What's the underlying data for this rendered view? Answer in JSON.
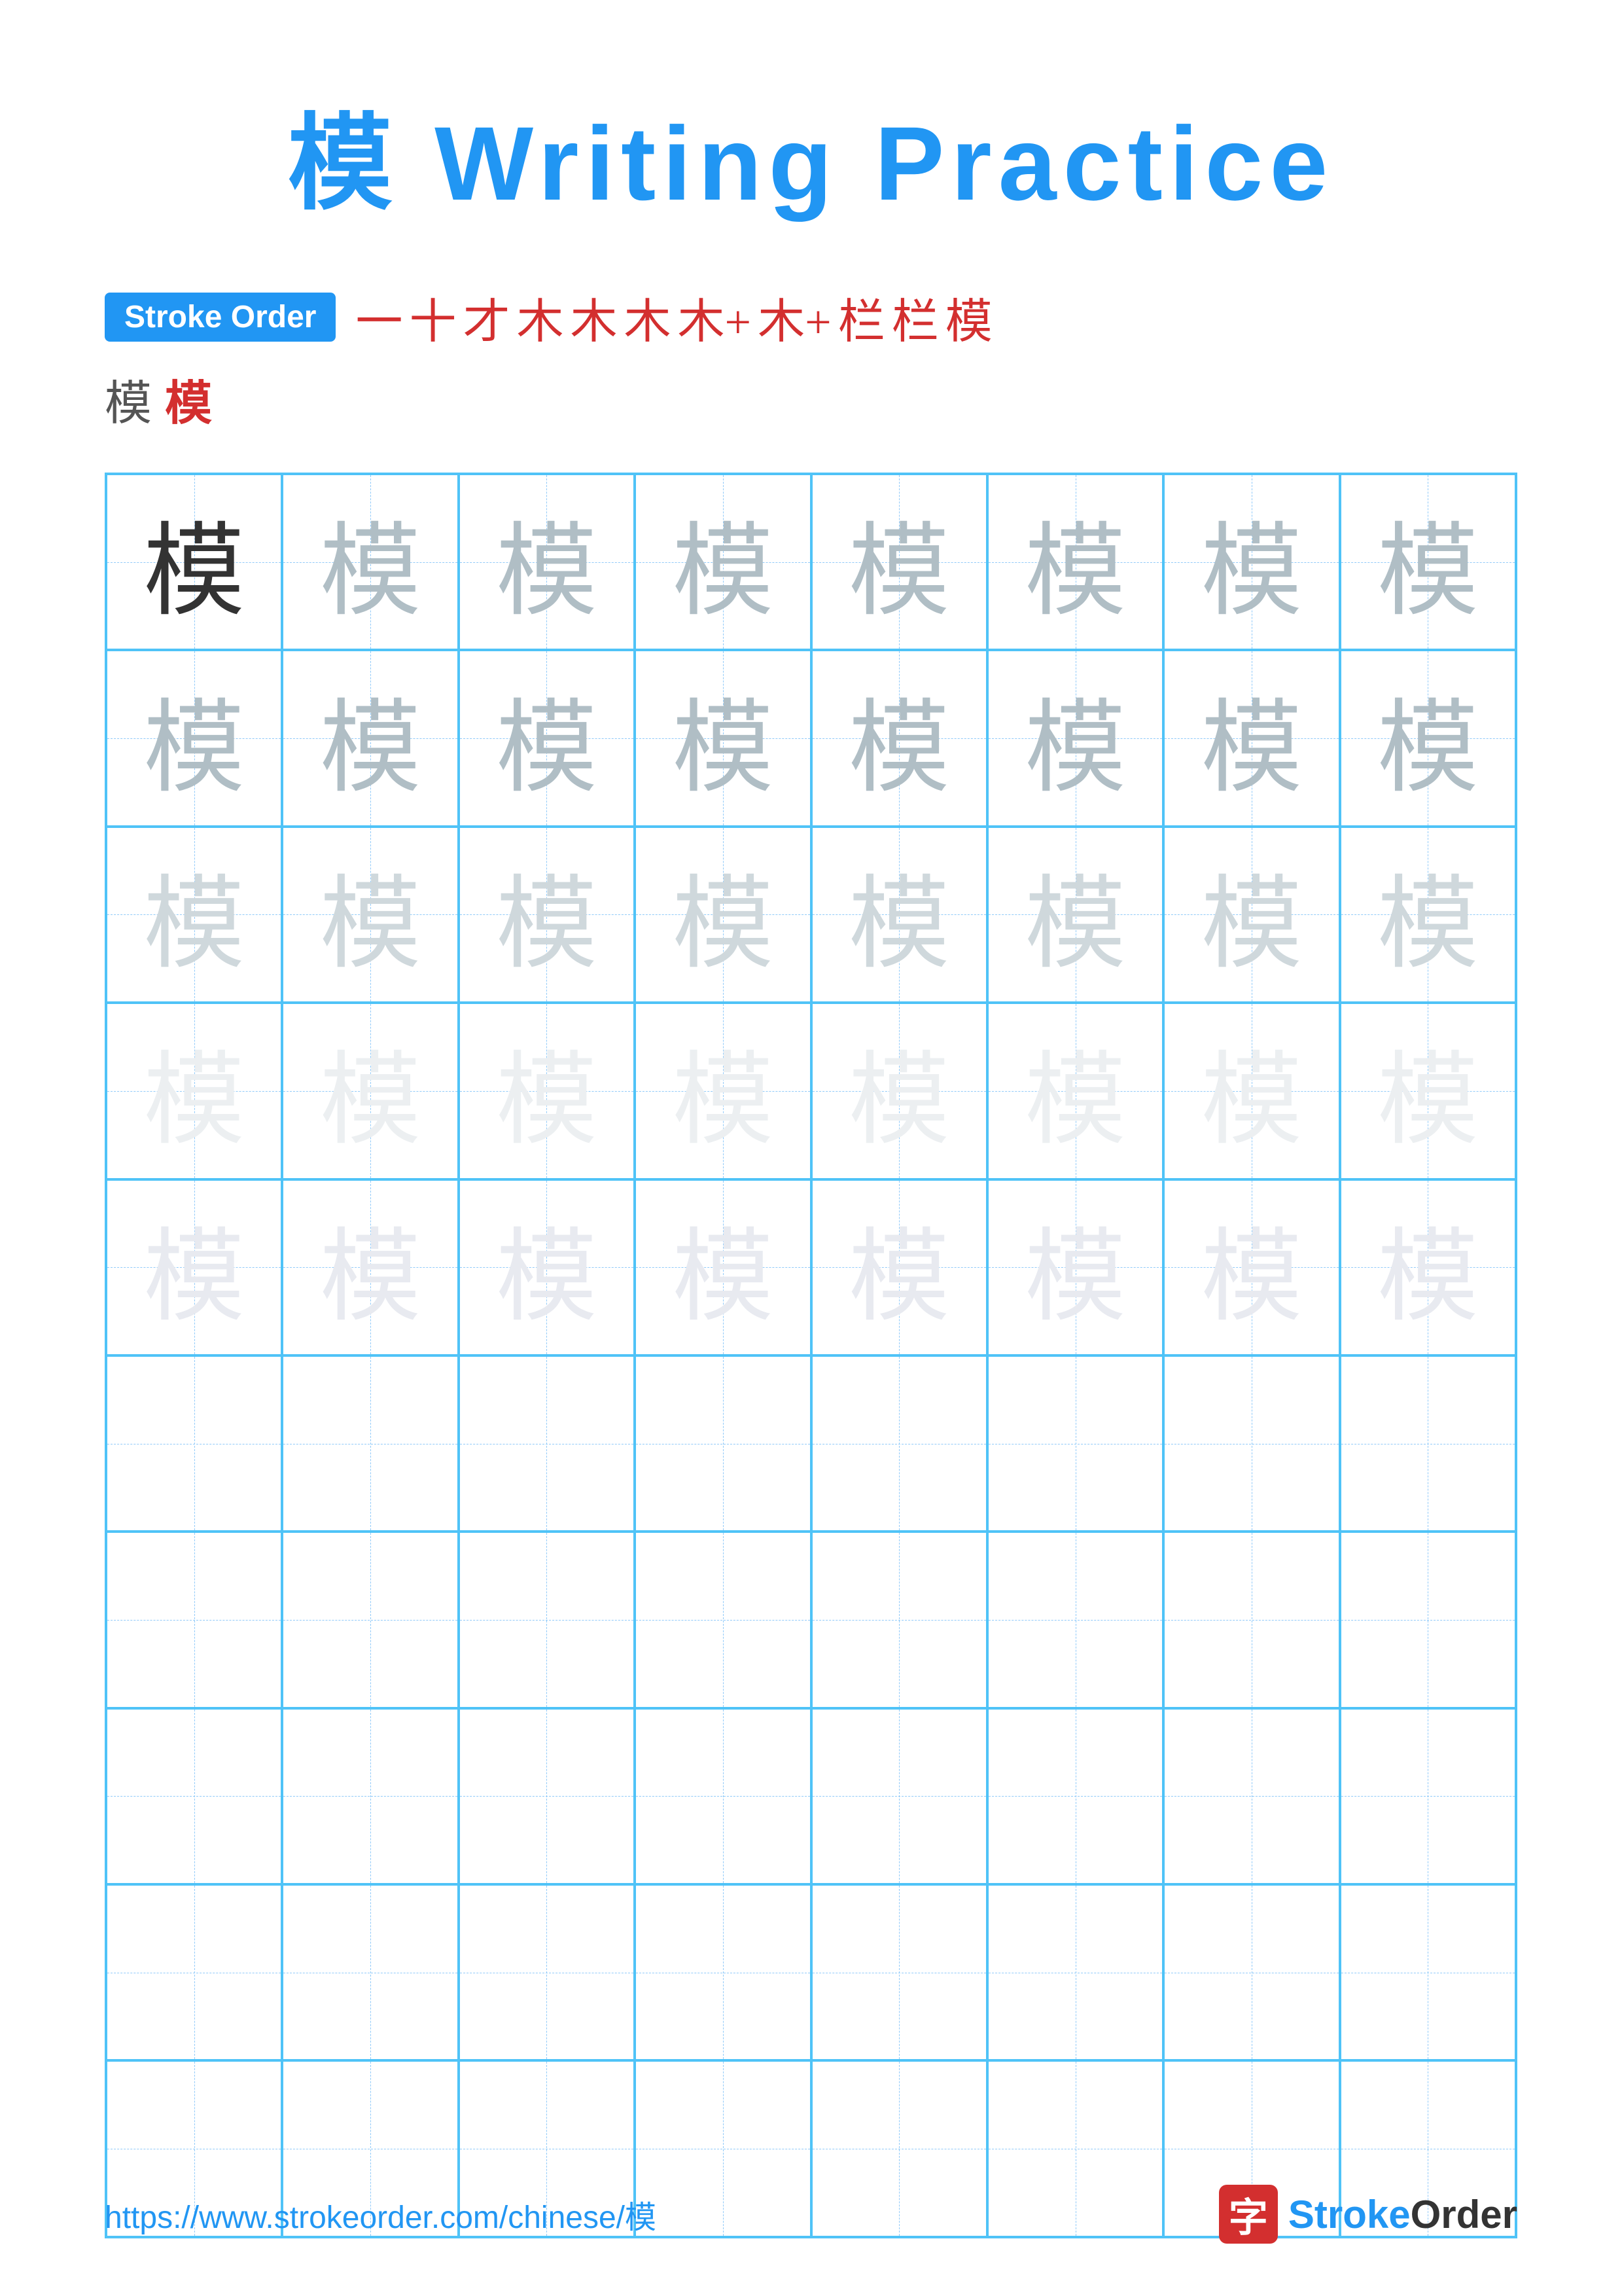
{
  "page": {
    "title": "模 Writing Practice",
    "stroke_order_label": "Stroke Order",
    "stroke_sequence": [
      "一",
      "十",
      "才",
      "木",
      "木",
      "木",
      "木+",
      "木+",
      "栏",
      "栏",
      "模"
    ],
    "stroke_row2": [
      "模",
      "模"
    ],
    "character": "模",
    "rows": [
      {
        "chars": [
          "dark",
          "light1",
          "light1",
          "light1",
          "light1",
          "light1",
          "light1",
          "light1"
        ]
      },
      {
        "chars": [
          "light1",
          "light1",
          "light1",
          "light1",
          "light1",
          "light1",
          "light1",
          "light1"
        ]
      },
      {
        "chars": [
          "light2",
          "light2",
          "light2",
          "light2",
          "light2",
          "light2",
          "light2",
          "light2"
        ]
      },
      {
        "chars": [
          "light3",
          "light3",
          "light3",
          "light3",
          "light3",
          "light3",
          "light3",
          "light3"
        ]
      },
      {
        "chars": [
          "very-light",
          "very-light",
          "very-light",
          "very-light",
          "very-light",
          "very-light",
          "very-light",
          "very-light"
        ]
      },
      {
        "chars": [
          "empty",
          "empty",
          "empty",
          "empty",
          "empty",
          "empty",
          "empty",
          "empty"
        ]
      },
      {
        "chars": [
          "empty",
          "empty",
          "empty",
          "empty",
          "empty",
          "empty",
          "empty",
          "empty"
        ]
      },
      {
        "chars": [
          "empty",
          "empty",
          "empty",
          "empty",
          "empty",
          "empty",
          "empty",
          "empty"
        ]
      },
      {
        "chars": [
          "empty",
          "empty",
          "empty",
          "empty",
          "empty",
          "empty",
          "empty",
          "empty"
        ]
      },
      {
        "chars": [
          "empty",
          "empty",
          "empty",
          "empty",
          "empty",
          "empty",
          "empty",
          "empty"
        ]
      }
    ],
    "footer": {
      "url": "https://www.strokeorder.com/chinese/模",
      "logo_char": "字",
      "logo_text": "StrokeOrder"
    }
  }
}
